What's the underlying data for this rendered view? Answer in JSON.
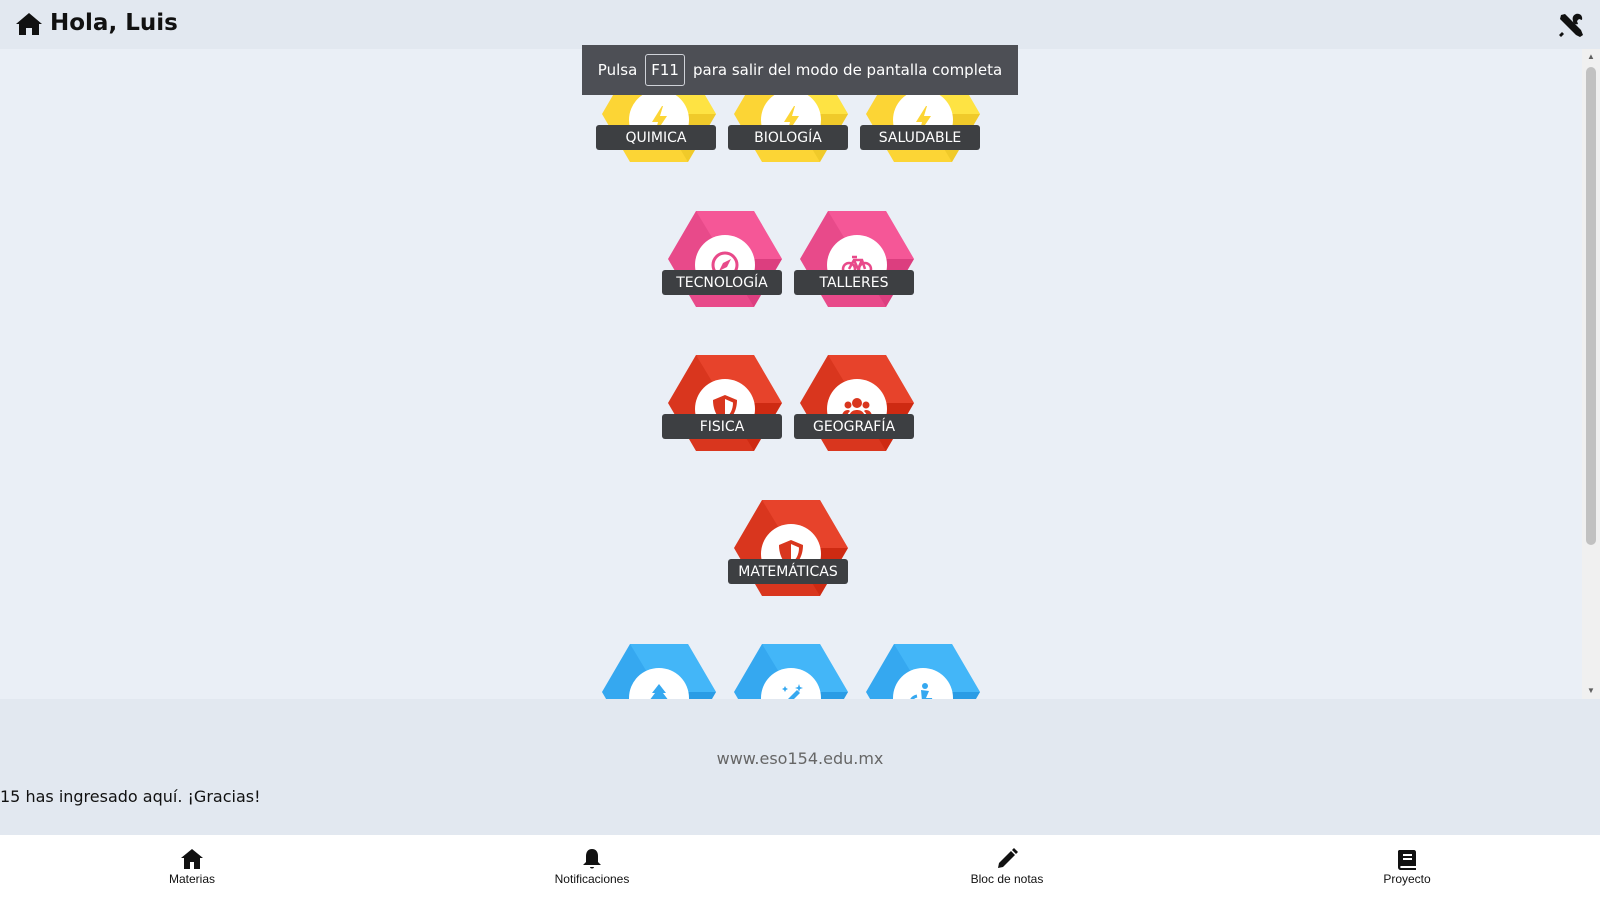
{
  "header": {
    "title": "Hola, Luis",
    "home_icon": "home-icon",
    "tools_icon": "tools-icon"
  },
  "toast": {
    "before": "Pulsa",
    "key": "F11",
    "after": "para salir del modo de pantalla completa"
  },
  "subjects": [
    {
      "label": "QUIMICA",
      "color": "#fcd535",
      "icon": "lightning-icon"
    },
    {
      "label": "BIOLOGÍA",
      "color": "#fcd535",
      "icon": "lightning-icon"
    },
    {
      "label": "SALUDABLE",
      "color": "#fcd535",
      "icon": "lightning-icon"
    },
    {
      "label": "TECNOLOGÍA",
      "color": "#e84a8a",
      "icon": "compass-icon"
    },
    {
      "label": "TALLERES",
      "color": "#e84a8a",
      "icon": "bicycle-icon"
    },
    {
      "label": "FISICA",
      "color": "#d9361e",
      "icon": "shield-icon"
    },
    {
      "label": "GEOGRAFÍA",
      "color": "#d9361e",
      "icon": "users-icon"
    },
    {
      "label": "MATEMÁTICAS",
      "color": "#d9361e",
      "icon": "shield-icon"
    },
    {
      "label": "",
      "color": "#35a8f0",
      "icon": "tree-icon"
    },
    {
      "label": "",
      "color": "#35a8f0",
      "icon": "magic-wand-icon"
    },
    {
      "label": "",
      "color": "#35a8f0",
      "icon": "wheelchair-icon"
    }
  ],
  "footer": {
    "site": "www.eso154.edu.mx",
    "visits": "15 has ingresado aquí. ¡Gracias!"
  },
  "nav": [
    {
      "label": "Materias",
      "icon": "home-icon"
    },
    {
      "label": "Notificaciones",
      "icon": "bell-icon"
    },
    {
      "label": "Bloc de notas",
      "icon": "pencil-icon"
    },
    {
      "label": "Proyecto",
      "icon": "book-icon"
    }
  ]
}
